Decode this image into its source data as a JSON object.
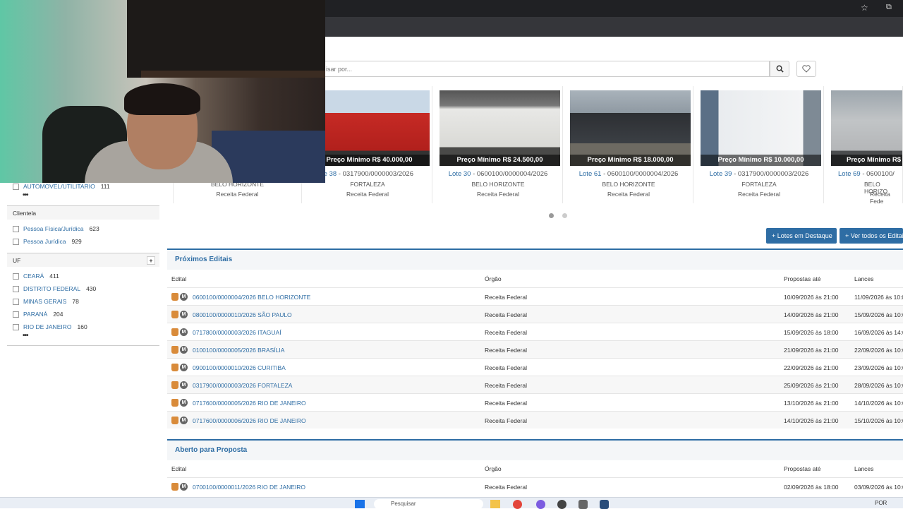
{
  "search": {
    "placeholder": "isar por..."
  },
  "carousel": [
    {
      "price": "Preço Mínimo R$ 40.000,00",
      "lote_label": "te 38",
      "lote_code": " - 0317900/0000003/2026",
      "city": "FORTALEZA",
      "org": "Receita Federal"
    },
    {
      "price": "Preço Mínimo R$ 24.500,00",
      "lote_label": "Lote 30",
      "lote_code": " - 0600100/0000004/2026",
      "city": "BELO HORIZONTE",
      "org": "Receita Federal"
    },
    {
      "price": "Preço Mínimo R$ 18.000,00",
      "lote_label": "Lote 61",
      "lote_code": " - 0600100/0000004/2026",
      "city": "BELO HORIZONTE",
      "org": "Receita Federal"
    },
    {
      "price": "Preço Mínimo R$ 10.000,00",
      "lote_label": "Lote 39",
      "lote_code": " - 0317900/0000003/2026",
      "city": "FORTALEZA",
      "org": "Receita Federal"
    },
    {
      "price": "Preço Mínimo R$",
      "lote_label": "Lote 69",
      "lote_code": " - 0600100/",
      "city": "BELO HORIZO",
      "org": "Receita Fede"
    }
  ],
  "partial_card": {
    "city": "BELO HORIZONTE",
    "org": "Receita Federal"
  },
  "sidebar": {
    "auto": {
      "label": "AUTOMOVEL/UTILITARIO",
      "count": "111"
    },
    "clientela_title": "Clientela",
    "clientela": [
      {
        "label": "Pessoa Física/Jurídica",
        "count": "623"
      },
      {
        "label": "Pessoa Jurídica",
        "count": "929"
      }
    ],
    "uf_title": "UF",
    "uf_plus": "+",
    "uf": [
      {
        "label": "CEARÁ",
        "count": "411"
      },
      {
        "label": "DISTRITO FEDERAL",
        "count": "430"
      },
      {
        "label": "MINAS GERAIS",
        "count": "78"
      },
      {
        "label": "PARANÁ",
        "count": "204"
      },
      {
        "label": "RIO DE JANEIRO",
        "count": "160"
      }
    ],
    "more": "•••"
  },
  "buttons": {
    "destaque": "+ Lotes em Destaque",
    "ver_todos": "+ Ver todos os Editais"
  },
  "proximos": {
    "title": "Próximos Editais",
    "headers": {
      "edital": "Edital",
      "orgao": "Órgão",
      "propostas": "Propostas até",
      "lances": "Lances"
    },
    "rows": [
      {
        "edital": "0600100/0000004/2026 BELO HORIZONTE",
        "orgao": "Receita Federal",
        "propostas": "10/09/2026 às 21:00",
        "lances": "11/09/2026 às 10:0"
      },
      {
        "edital": "0800100/0000010/2026 SÃO PAULO",
        "orgao": "Receita Federal",
        "propostas": "14/09/2026 às 21:00",
        "lances": "15/09/2026 às 10:0"
      },
      {
        "edital": "0717800/0000003/2026 ITAGUAÍ",
        "orgao": "Receita Federal",
        "propostas": "15/09/2026 às 18:00",
        "lances": "16/09/2026 às 14:0"
      },
      {
        "edital": "0100100/0000005/2026 BRASÍLIA",
        "orgao": "Receita Federal",
        "propostas": "21/09/2026 às 21:00",
        "lances": "22/09/2026 às 10:0"
      },
      {
        "edital": "0900100/0000010/2026 CURITIBA",
        "orgao": "Receita Federal",
        "propostas": "22/09/2026 às 21:00",
        "lances": "23/09/2026 às 10:0"
      },
      {
        "edital": "0317900/0000003/2026 FORTALEZA",
        "orgao": "Receita Federal",
        "propostas": "25/09/2026 às 21:00",
        "lances": "28/09/2026 às 10:0"
      },
      {
        "edital": "0717600/0000005/2026 RIO DE JANEIRO",
        "orgao": "Receita Federal",
        "propostas": "13/10/2026 às 21:00",
        "lances": "14/10/2026 às 10:0"
      },
      {
        "edital": "0717600/0000006/2026 RIO DE JANEIRO",
        "orgao": "Receita Federal",
        "propostas": "14/10/2026 às 21:00",
        "lances": "15/10/2026 às 10:0"
      }
    ]
  },
  "aberto": {
    "title": "Aberto para Proposta",
    "headers": {
      "edital": "Edital",
      "orgao": "Órgão",
      "propostas": "Propostas até",
      "lances": "Lances"
    },
    "rows": [
      {
        "edital": "0700100/0000011/2026 RIO DE JANEIRO",
        "orgao": "Receita Federal",
        "propostas": "02/09/2026 às 18:00",
        "lances": "03/09/2026 às 10:0"
      }
    ]
  },
  "taskbar": {
    "search": "Pesquisar",
    "lang": "POR"
  },
  "colors": {
    "accent": "#2e6da4",
    "lock": "#d98b3a"
  }
}
